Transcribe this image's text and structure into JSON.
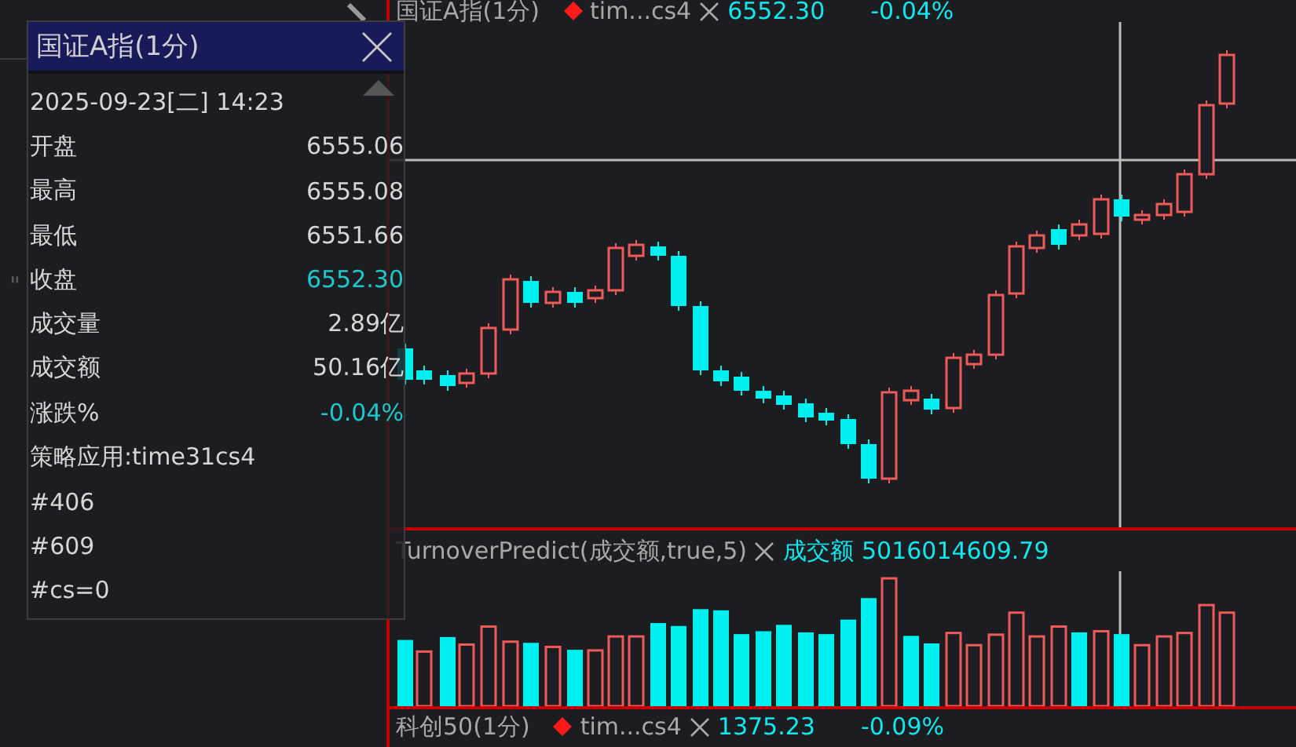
{
  "background_code": "\"",
  "popup": {
    "title": "国证A指(1分)",
    "datetime": "2025-09-23[二] 14:23",
    "rows": [
      {
        "label": "开盘",
        "value": "6555.06",
        "color": "#d6d6d6"
      },
      {
        "label": "最高",
        "value": "6555.08",
        "color": "#d6d6d6"
      },
      {
        "label": "最低",
        "value": "6551.66",
        "color": "#d6d6d6"
      },
      {
        "label": "收盘",
        "value": "6552.30",
        "color": "#1cc8cc"
      },
      {
        "label": "成交量",
        "value": "2.89亿",
        "color": "#d6d6d6"
      },
      {
        "label": "成交额",
        "value": "50.16亿",
        "color": "#d6d6d6"
      },
      {
        "label": "涨跌%",
        "value": "-0.04%",
        "color": "#1cc8cc"
      },
      {
        "label": "策略应用:time31cs4"
      },
      {
        "label": "#406"
      },
      {
        "label": "#609"
      },
      {
        "label": "#cs=0"
      }
    ]
  },
  "main_header": {
    "title": "国证A指(1分)",
    "strategy": "tim...cs4",
    "price": "6552.30",
    "change": "-0.04%"
  },
  "volume_header": {
    "formula": "TurnoverPredict(成交额,true,5)",
    "series": "成交额",
    "value": "5016014609.79"
  },
  "bottom_header": {
    "title": "科创50(1分)",
    "strategy": "tim...cs4",
    "price": "1375.23",
    "change": "-0.09%"
  }
}
